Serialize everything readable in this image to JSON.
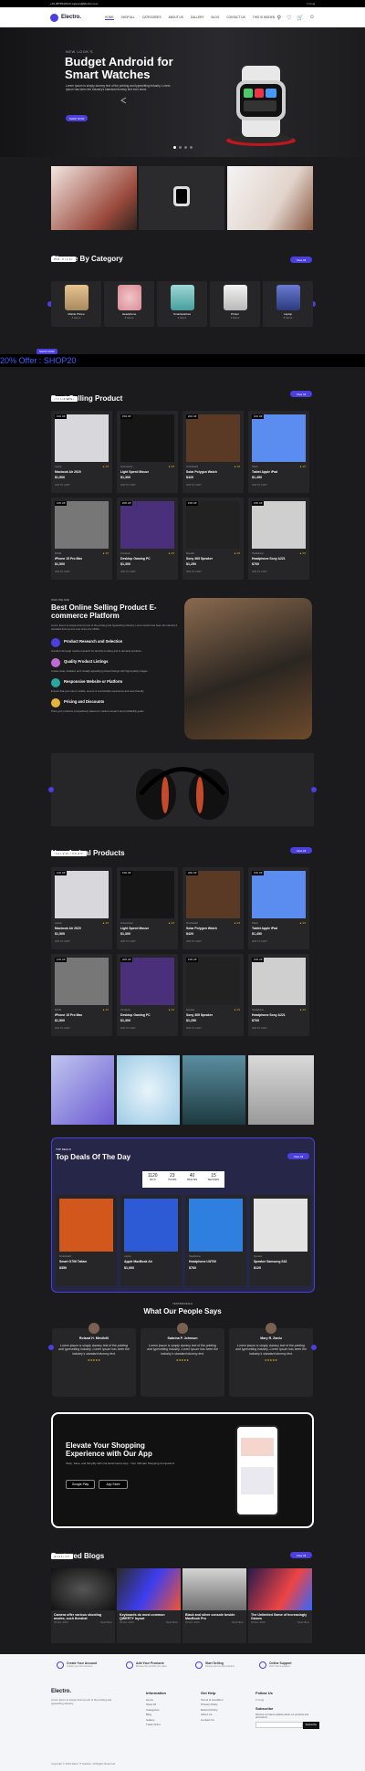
{
  "topbar": {
    "left": "+91 9876543210  support@Electro.com",
    "right": "f t in ig"
  },
  "nav": {
    "logo": "Electro.",
    "links": [
      "HOME",
      "SHOP ALL",
      "CATEGORIES",
      "ABOUT US",
      "GALLERY",
      "BLOG",
      "CONTACT US",
      "THIS IS HIDDEN"
    ]
  },
  "hero": {
    "kicker": "NEW LOOK'S",
    "title": "Budget Android for Smart Watches",
    "text": "Lorem Ipsum is simply dummy text of the printing and typesetting industry. Lorem Ipsum has been the industry's standard dummy text ever since.",
    "button": "SHOP NOW"
  },
  "categories": {
    "tag": "OUR TOP LIST",
    "title": "Choose By Category",
    "view_all": "View All",
    "items": [
      {
        "name": "Mobile Phone",
        "count": "5 Items"
      },
      {
        "name": "Headphone",
        "count": "6 Items"
      },
      {
        "name": "Smartwatches",
        "count": "4 Items"
      },
      {
        "name": "Printer",
        "count": "3 Items"
      },
      {
        "name": "Laptop",
        "count": "8 Items"
      }
    ]
  },
  "ticker": "20% Offer : SHOP20",
  "ticker_badge": "SHOP NOW",
  "best": {
    "tag": "TOP TRENDING",
    "title": "Best Selling Product",
    "view_all": "View All"
  },
  "products": [
    {
      "badge": "10% Off",
      "cat": "Laptop",
      "name": "Macbook Air 2020",
      "price": "$1,500",
      "rating": "★ 4.5",
      "action": "ADD TO CART"
    },
    {
      "badge": "15% Off",
      "cat": "Accessories",
      "name": "Light Speed Mouse",
      "price": "$1,300",
      "rating": "★ 4.5",
      "action": "ADD TO CART"
    },
    {
      "badge": "20% Off",
      "cat": "Smartwatch",
      "name": "Solar Polygon Watch",
      "price": "$420",
      "rating": "★ 4.5",
      "action": "ADD TO CART"
    },
    {
      "badge": "10% Off",
      "cat": "Tablet",
      "name": "Tablet Apple iPad",
      "price": "$1,450",
      "rating": "★ 4.5",
      "action": "ADD TO CART"
    },
    {
      "badge": "10% Off",
      "cat": "Mobile",
      "name": "iPhone 15 Pro Max",
      "price": "$1,500",
      "rating": "★ 4.5",
      "action": "ADD TO CART"
    },
    {
      "badge": "20% Off",
      "cat": "Computer",
      "name": "Desktop Gaming PC",
      "price": "$1,300",
      "rating": "★ 4.5",
      "action": "ADD TO CART"
    },
    {
      "badge": "15% Off",
      "cat": "Speaker",
      "name": "Sony 365 Speaker",
      "price": "$1,250",
      "rating": "★ 4.5",
      "action": "ADD TO CART"
    },
    {
      "badge": "15% Off",
      "cat": "Headphone",
      "name": "Headphone Sony A221",
      "price": "$760",
      "rating": "★ 4.5",
      "action": "ADD TO CART"
    }
  ],
  "who": {
    "tag": "WHO WE ARE",
    "title": "Best Online Selling Product E-commerce Platform",
    "text": "Lorem Ipsum is simply dummy text of the printing and typesetting industry. Lorem Ipsum has been the industry's standard dummy text ever since the 1500s.",
    "features": [
      {
        "t": "Product Research and Selection",
        "d": "Conduct thorough market research for identify trending and in-demand products."
      },
      {
        "t": "Quality Product Listings",
        "d": "Create clear, detailed, and visually appealing product listings with high-quality images."
      },
      {
        "t": "Responsive Website or Platform",
        "d": "Ensure that your site is mobile, secure & comfortable experience and user-friendly."
      },
      {
        "t": "Pricing and Discounts",
        "d": "Price your products competitively based on market research and profitability goals."
      }
    ]
  },
  "arrival": {
    "tag": "OUR NEW LAUNCHING",
    "title": "New Arrival Products",
    "view_all": "View All"
  },
  "deals": {
    "tag": "TOP DEALS",
    "title": "Top Deals Of The Day",
    "view_all": "View All",
    "timer": [
      {
        "v": "1120",
        "l": "DAYS"
      },
      {
        "v": "23",
        "l": "HOURS"
      },
      {
        "v": "40",
        "l": "MINUTES"
      },
      {
        "v": "15",
        "l": "SECONDS"
      }
    ],
    "items": [
      {
        "cat": "Smartwatch",
        "name": "Smart G706 Tallam",
        "price": "$350"
      },
      {
        "cat": "Laptop",
        "name": "Apple MacBook Air",
        "price": "$1,000"
      },
      {
        "cat": "Headphone",
        "name": "Headphone LW700",
        "price": "$760"
      },
      {
        "cat": "Speaker",
        "name": "Speaker Samsung S42",
        "price": "$120"
      }
    ]
  },
  "testimonials": {
    "tag": "TESTIMONIALS",
    "title": "What Our People Says",
    "items": [
      {
        "name": "Roland H. Mirvilelli",
        "quote": "Lorem Ipsum is simply dummy text of the printing and typesetting industry. Lorem Ipsum has been the industry's standard dummy text.",
        "stars": "★★★★★"
      },
      {
        "name": "Sabrina P. Johnson",
        "quote": "Lorem Ipsum is simply dummy text of the printing and typesetting industry. Lorem Ipsum has been the industry's standard dummy text.",
        "stars": "★★★★★"
      },
      {
        "name": "Mary R. Zaniu",
        "quote": "Lorem Ipsum is simply dummy text of the printing and typesetting industry. Lorem Ipsum has been the industry's standard dummy text.",
        "stars": "★★★★★"
      }
    ]
  },
  "app": {
    "title": "Elevate Your Shopping Experience with Our App",
    "text": "Shop, Save, and Simplify with Our Ecommerce App - Your Ultimate Shopping Companion!",
    "google": "Google Play",
    "apple": "App Store"
  },
  "blogs": {
    "tag": "NEW BLOGS",
    "title": "Featured Blogs",
    "view_all": "View All",
    "items": [
      {
        "t": "Camera offer various shooting modes, such thewhat",
        "date": "20 Dec, 2023",
        "more": "Read More"
      },
      {
        "t": "Keyboards do most common QWERTY layout",
        "date": "20 Dec, 2023",
        "more": "Read More"
      },
      {
        "t": "Black and silver console beside MacBook Pro",
        "date": "20 Dec, 2023",
        "more": "Read More"
      },
      {
        "t": "The Unlimited Game of Increasingly Games",
        "date": "20 Dec, 2023",
        "more": "Read More"
      }
    ]
  },
  "footer": {
    "stats": [
      {
        "t": "Create Your Account",
        "d": "Create your first account"
      },
      {
        "t": "Add Your Products",
        "d": "Browse the product you want"
      },
      {
        "t": "Start Selling",
        "d": "Simply start to sell products"
      },
      {
        "t": "Online Support",
        "d": "24x7 online support"
      }
    ],
    "logo": "Electro.",
    "about": "Lorem Ipsum is simply dummy text of the printing and typesetting industry.",
    "cols": [
      {
        "h": "Information",
        "i": [
          "Home",
          "Shop All",
          "Categories",
          "Blog",
          "Gallery",
          "Track Order"
        ]
      },
      {
        "h": "Get Help",
        "i": [
          "Terms & Condition",
          "Privacy Policy",
          "Refund Policy",
          "About Us",
          "Contact Us"
        ]
      },
      {
        "h": "Follow Us",
        "i": [
          "f  t  in  ig"
        ]
      }
    ],
    "subscribe": "Subscribe",
    "sub_text": "Receive our latest updates about our products and promotions.",
    "sub_btn": "Subscribe",
    "copyright": "Copyright © 2024 Razor IT Solution. All Rights Reserved."
  }
}
